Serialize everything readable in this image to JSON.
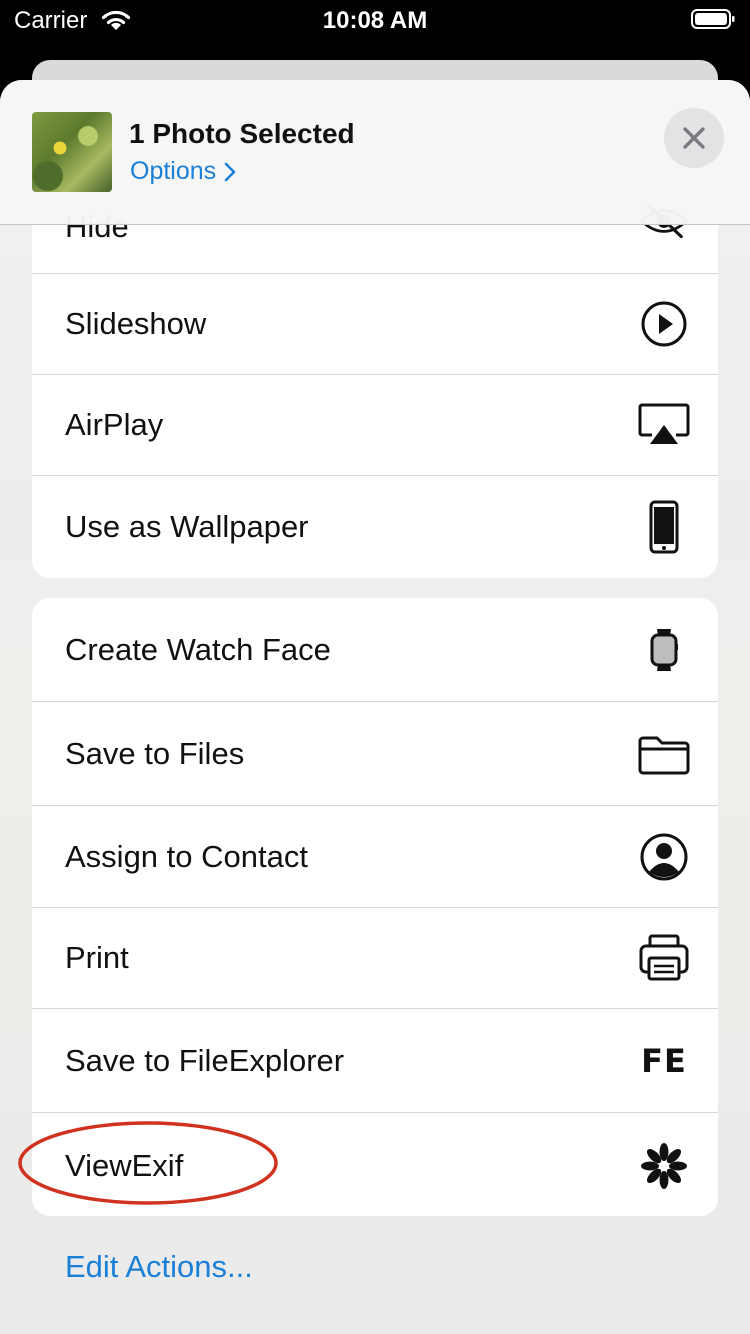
{
  "status_bar": {
    "carrier": "Carrier",
    "time": "10:08 AM"
  },
  "header": {
    "title": "1 Photo Selected",
    "options_label": "Options"
  },
  "group1": [
    {
      "label": "Hide",
      "icon": "eye-slash-icon"
    },
    {
      "label": "Slideshow",
      "icon": "play-circle-icon"
    },
    {
      "label": "AirPlay",
      "icon": "airplay-icon"
    },
    {
      "label": "Use as Wallpaper",
      "icon": "iphone-icon"
    }
  ],
  "group2": [
    {
      "label": "Create Watch Face",
      "icon": "applewatch-icon"
    },
    {
      "label": "Save to Files",
      "icon": "folder-icon"
    },
    {
      "label": "Assign to Contact",
      "icon": "person-circle-icon"
    },
    {
      "label": "Print",
      "icon": "printer-icon"
    },
    {
      "label": "Save to FileExplorer",
      "icon": "fe-icon",
      "icon_text": "FE"
    },
    {
      "label": "ViewExif",
      "icon": "asterisk-icon"
    }
  ],
  "edit_actions": "Edit Actions...",
  "colors": {
    "accent": "#1a7fd6",
    "annotation": "#d0321f"
  }
}
